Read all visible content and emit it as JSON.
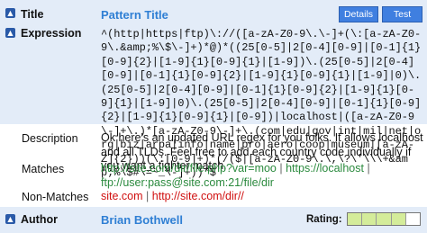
{
  "title": {
    "label": "Title",
    "value": "Pattern Title"
  },
  "buttons": {
    "details": "Details",
    "test": "Test"
  },
  "expression": {
    "label": "Expression",
    "value": "^(http|https|ftp)\\://([a-zA-Z0-9\\.\\-]+(\\:[a-zA-Z0-9\\.&amp;%\\$\\-]+)*@)*((25[0-5]|2[0-4][0-9]|[0-1]{1}[0-9]{2}|[1-9]{1}[0-9]{1}|[1-9])\\.(25[0-5]|2[0-4][0-9]|[0-1]{1}[0-9]{2}|[1-9]{1}[0-9]{1}|[1-9]|0)\\.(25[0-5]|2[0-4][0-9]|[0-1]{1}[0-9]{2}|[1-9]{1}[0-9]{1}|[1-9]|0)\\.(25[0-5]|2[0-4][0-9]|[0-1]{1}[0-9]{2}|[1-9]{1}[0-9]{1}|[0-9])|localhost|([a-zA-Z0-9\\-]+\\.)*[a-zA-Z0-9\\-]+\\.(com|edu|gov|int|mil|net|org|biz|arpa|info|name|pro|aero|coop|museum|[a-zA-Z]{2}))(\\:[0-9]+)*(/($|[a-zA-Z0-9\\.\\,\\?\\'\\\\\\+&amp;%\\$#\\=~_\\-]+))*$"
  },
  "description": {
    "label": "Description",
    "value": "Ok here's an updated URL regex for you folks. It allows localhost and all TLDs. Feel free to add each country code individually if you want a tighter match."
  },
  "matches": {
    "label": "Matches",
    "items": [
      "http://site.com/dir/file.php?var=moo",
      "https://localhost",
      "ftp://user:pass@site.com:21/file/dir"
    ],
    "separator": "|"
  },
  "non_matches": {
    "label": "Non-Matches",
    "items": [
      "site.com",
      "http://site.com/dir//"
    ],
    "separator": "|"
  },
  "author": {
    "label": "Author",
    "value": "Brian Bothwell"
  },
  "rating": {
    "label": "Rating:",
    "value": 4,
    "max": 5
  },
  "colors": {
    "accent": "#2f7fd4",
    "match": "#2b8a3e",
    "non_match": "#d01010",
    "rating_fill": "#d4ec9a",
    "band": "#e3ecf8"
  },
  "icons": {
    "toggle": "collapse-arrow-icon"
  }
}
